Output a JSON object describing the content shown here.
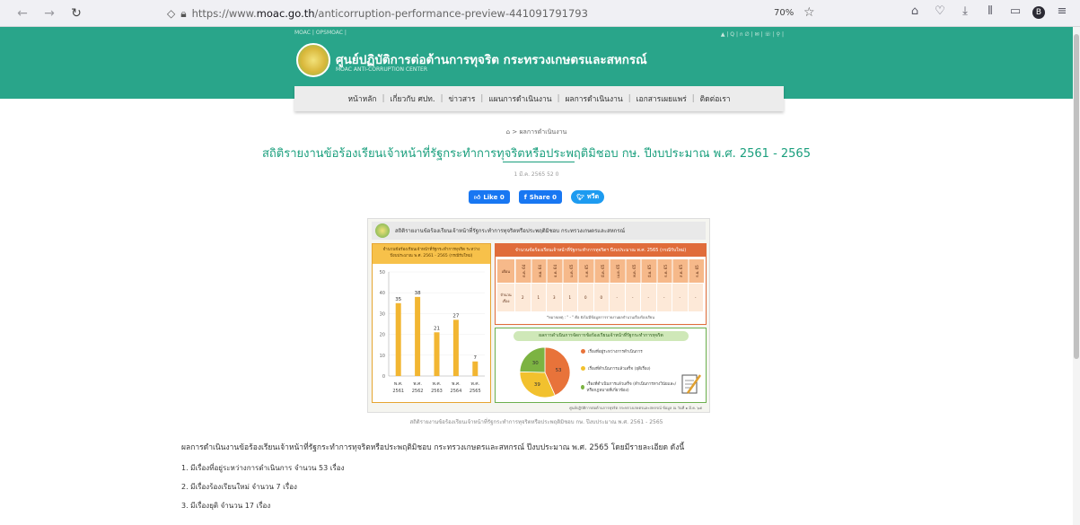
{
  "browser": {
    "url_prefix": "https://www.",
    "url_domain": "moac.go.th",
    "url_path": "/anticorruption-performance-preview-441091791793",
    "zoom": "70%"
  },
  "site": {
    "topbar_left": "MOAC | OPSMOAC |",
    "topbar_right": "▲ | Q | ก ∅ | ✉ | ☏ | ⚲ |",
    "title": "ศูนย์ปฏิบัติการต่อต้านการทุจริต กระทรวงเกษตรและสหกรณ์",
    "subtitle": "MOAC ANTI-CORRUPTION CENTER",
    "menu": [
      "หน้าหลัก",
      "เกี่ยวกับ ศปท.",
      "ข่าวสาร",
      "แผนการดำเนินงาน",
      "ผลการดำเนินงาน",
      "เอกสารเผยแพร่",
      "ติดต่อเรา"
    ]
  },
  "page": {
    "breadcrumb": "ผลการดำเนินงาน",
    "title": "สถิติรายงานข้อร้องเรียนเจ้าหน้าที่รัฐกระทำการทุจริตหรือประพฤติมิชอบ กษ. ปีงบประมาณ พ.ศ. 2561 - 2565",
    "meta": "1 มี.ค. 2565   52   0",
    "like": "Like 0",
    "share": "Share 0",
    "tweet": "ทวีต",
    "caption": "สถิติรายงานข้อร้องเรียนเจ้าหน้าที่รัฐกระทำการทุจริตหรือประพฤติมิชอบ กษ. ปีงบประมาณ พ.ศ. 2561 - 2565",
    "paragraph": "ผลการดำเนินงานข้อร้องเรียนเจ้าหน้าที่รัฐกระทำการทุจริตหรือประพฤติมิชอบ กระทรวงเกษตรและสหกรณ์ ปีงบประมาณ พ.ศ. 2565 โดยมีรายละเอียด ดังนี้",
    "items": [
      "1. มีเรื่องที่อยู่ระหว่างการดำเนินการ จำนวน 53 เรื่อง",
      "2. มีเรื่องร้องเรียนใหม่ จำนวน 7 เรื่อง",
      "3. มีเรื่องยุติ จำนวน 17 เรื่อง"
    ]
  },
  "infographic": {
    "header": "สถิติรายงานข้อร้องเรียนเจ้าหน้าที่รัฐกระทำการทุจริตหรือประพฤติมิชอบ กระทรวงเกษตรและสหกรณ์",
    "bar_head": "จำนวนข้อร้องเรียนเจ้าหน้าที่รัฐกระทำการทุจริต ระหว่างปีงบประมาณ พ.ศ. 2561 - 2565 (กรณีรับใหม่)",
    "table_head": "จำนวนข้อร้องเรียนเจ้าหน้าที่รัฐกระทำการทุจริตฯ ปีงบประมาณ พ.ศ. 2565 (กรณีรับใหม่)",
    "table_row1_label": "เดือน",
    "table_row2_label": "จำนวน เรื่อง",
    "months": [
      "ต.ค. 64",
      "พ.ย. 64",
      "ธ.ค. 64",
      "ม.ค. 65",
      "ก.พ. 65",
      "มี.ค. 65",
      "เม.ย. 65",
      "พ.ค. 65",
      "มิ.ย. 65",
      "ก.ค. 65",
      "ส.ค. 65",
      "ก.ย. 65"
    ],
    "monthly_values": [
      "2",
      "1",
      "3",
      "1",
      "0",
      "0",
      "-",
      "-",
      "-",
      "-",
      "-",
      "-"
    ],
    "table_note": "*หมายเหตุ : \" - \" คือ ยังไม่มีข้อมูลการรายงานผลจำนวนเรื่องร้องเรียน",
    "pie_head": "ผลการดำเนินการจัดการข้อร้องเรียนเจ้าหน้าที่รัฐกระทำการทุจริต",
    "legend": [
      {
        "label": "เรื่องที่อยู่ระหว่างการดำเนินการ",
        "color": "#e8733a"
      },
      {
        "label": "เรื่องที่ดำเนินการแล้วเสร็จ (ยุติเรื่อง)",
        "color": "#f2c12e"
      },
      {
        "label": "เรื่องที่ดำเนินการแล้วเสร็จ (ดำเนินการทางวินัยและ/หรือกฎหมายที่เกี่ยวข้อง)",
        "color": "#7cb342"
      }
    ],
    "footer": "ศูนย์ปฏิบัติการต่อต้านการทุจริต กระทรวงเกษตรและสหกรณ์     ข้อมูล ณ วันที่ ๑ มี.ค. ๖๕"
  },
  "chart_data": [
    {
      "type": "bar",
      "categories": [
        "พ.ศ. 2561",
        "พ.ศ. 2562",
        "พ.ศ. 2563",
        "พ.ศ. 2564",
        "พ.ศ. 2565"
      ],
      "values": [
        35,
        38,
        21,
        27,
        7
      ],
      "ylim": [
        0,
        50
      ],
      "yticks": [
        0,
        10,
        20,
        30,
        40,
        50
      ],
      "color": "#f2b632"
    },
    {
      "type": "pie",
      "labels": [
        "เรื่องที่อยู่ระหว่างการดำเนินการ",
        "เรื่องที่ดำเนินการแล้วเสร็จ (ยุติเรื่อง)",
        "เรื่องที่ดำเนินการแล้วเสร็จ (ดำเนินการทางวินัยและ/หรือกฎหมายที่เกี่ยวข้อง)"
      ],
      "values": [
        53,
        39,
        30
      ],
      "colors": [
        "#e8733a",
        "#f2c12e",
        "#7cb342"
      ]
    }
  ]
}
